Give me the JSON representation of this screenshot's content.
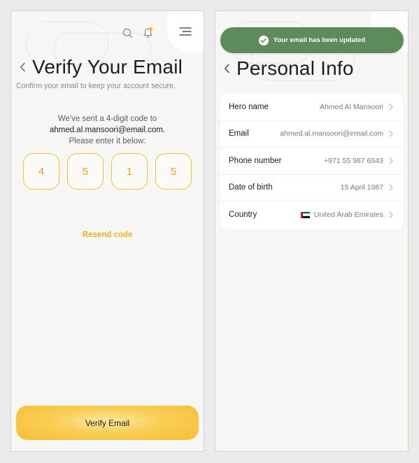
{
  "verify_screen": {
    "title": "Verify Your Email",
    "subtitle": "Confirm your email to keep your account secure.",
    "sent_line_1": "We've sent a 4-digit code to",
    "email": "ahmed.al.mansoori@email.com.",
    "sent_line_3": "Please enter it below:",
    "code_digits": [
      "4",
      "5",
      "1",
      "5"
    ],
    "resend_label": "Resend code",
    "verify_button_label": "Verify Email",
    "icons": {
      "search": "search-icon",
      "notifications": "bell-icon",
      "menu": "menu-icon",
      "back": "chevron-left-icon"
    },
    "accent_color": "#f5be34"
  },
  "personal_info_screen": {
    "toast": {
      "message": "Your email has been updated",
      "icon": "check-circle-icon",
      "color": "#5d8b5a"
    },
    "title": "Personal Info",
    "rows": [
      {
        "label": "Hero name",
        "value": "Ahmed Al Mansoori"
      },
      {
        "label": "Email",
        "value": "ahmed.al.mansoori@email.com"
      },
      {
        "label": "Phone number",
        "value": "+971 55 987 6543"
      },
      {
        "label": "Date of birth",
        "value": "15 April 1987"
      },
      {
        "label": "Country",
        "value": "United Arab Emirates",
        "flag": "uae-flag-icon"
      }
    ]
  }
}
